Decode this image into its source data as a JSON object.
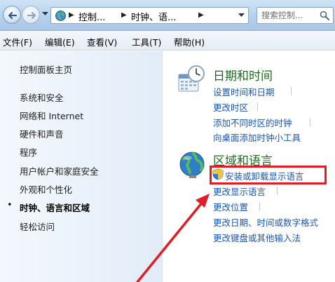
{
  "address_bar": {
    "crumbs": [
      "控制...",
      "时钟、语...",
      ""
    ],
    "search_placeholder": "搜索控制..."
  },
  "menu": {
    "items": [
      "文件(F)",
      "编辑(E)",
      "查看(V)",
      "工具(T)",
      "帮助(H)"
    ]
  },
  "sidebar": {
    "home": "控制面板主页",
    "items": [
      {
        "label": "系统和安全",
        "active": false
      },
      {
        "label": "网络和 Internet",
        "active": false
      },
      {
        "label": "硬件和声音",
        "active": false
      },
      {
        "label": "程序",
        "active": false
      },
      {
        "label": "用户帐户和家庭安全",
        "active": false
      },
      {
        "label": "外观和个性化",
        "active": false
      },
      {
        "label": "时钟、语言和区域",
        "active": true
      },
      {
        "label": "轻松访问",
        "active": false
      }
    ]
  },
  "main": {
    "datetime": {
      "title": "日期和时间",
      "tasks": [
        "设置时间和日期",
        "更改时区",
        "添加不同时区的时钟",
        "向桌面添加时钟小工具"
      ]
    },
    "region": {
      "title": "区域和语言",
      "tasks": [
        "安装或卸载显示语言",
        "更改显示语言",
        "更改位置",
        "更改日期、时间或数字格式",
        "更改键盘或其他输入法"
      ]
    }
  },
  "colors": {
    "category_title": "#1e6b1e",
    "task_link": "#1a55b5",
    "highlight": "#e21c24"
  },
  "icons": [
    "back-arrow-icon",
    "forward-arrow-icon",
    "globe-icon",
    "search-icon",
    "calendar-clock-icon",
    "globe-region-icon",
    "uac-shield-icon"
  ]
}
